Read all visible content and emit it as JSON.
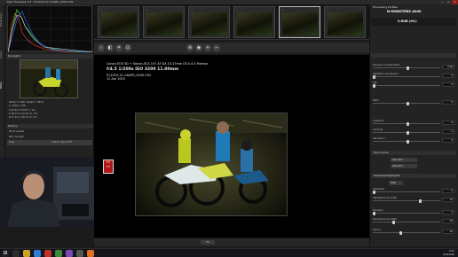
{
  "window": {
    "title": "Raw Therapee 5.8 - E:\\2019-12-14\\IMG_0030.CR2",
    "minimize": "—",
    "maximize": "□",
    "close": "✕"
  },
  "left_tabs": [
    "File Browser",
    "Queue",
    "Editor"
  ],
  "histogram": {
    "colors": {
      "red": "#d03030",
      "green": "#30c030",
      "blue": "#3050e0",
      "luma": "#e0e0e0"
    }
  },
  "navigator": {
    "title": "Navigator",
    "info_lines": [
      "Width = 5796, Height = 3870",
      "x: 1160  y: 768",
      "R  26.6%   H  29.8°   L*  8.1",
      "G  30.1%   S  22.9%   a*  -3.0",
      "B  27.1%   V  30.1%   b*  4.5"
    ]
  },
  "history": {
    "title": "History",
    "items": [
      {
        "label": "Photo loaded"
      },
      {
        "label": "PP3 changed"
      },
      {
        "label": "Crop",
        "detail": "Left=0, Top=2375"
      }
    ]
  },
  "filmstrip": {
    "star": "☆"
  },
  "toolbar": {
    "icons": [
      "info-icon",
      "before-after-icon",
      "crop-icon",
      "zoom-fit-icon",
      "lock-icon",
      "zoom-100-icon",
      "zoom-in-icon",
      "zoom-out-icon"
    ]
  },
  "exif": {
    "camera": "Canon EOS 5D + Tokina AT-X 107 AF DX 10-17mm f/3.5-4.5 Fisheye",
    "settings": "f/4.5   1/200s   ISO 3200   11.00mm",
    "file": "E:\\2019-12-14\\IMG_0030.CR2",
    "date": "12 Apr 2019"
  },
  "right_panel": {
    "title": "Processing Profiles",
    "watermark": "N-MONSTERS A400",
    "profile_name": "0.RUB (0%)",
    "sections": [
      {
        "name": "Tone Curve"
      },
      {
        "name": "Shadows/Highlights"
      }
    ],
    "sliders": [
      {
        "label": "Exposure compensation",
        "value": "0.00",
        "pos": 0.5
      },
      {
        "label": "Highlight compression",
        "value": "0",
        "pos": 0.0
      },
      {
        "label": "Clip",
        "value": "0",
        "pos": 0.0
      },
      {
        "label": "Black",
        "value": "0",
        "pos": 0.5
      },
      {
        "label": "Lightness",
        "value": "0",
        "pos": 0.5
      },
      {
        "label": "Contrast",
        "value": "0",
        "pos": 0.5
      },
      {
        "label": "Saturation",
        "value": "0",
        "pos": 0.5
      },
      {
        "label": "Highlights",
        "value": "0",
        "pos": 0.0
      },
      {
        "label": "Highlight tonal width",
        "value": "70",
        "pos": 0.7
      },
      {
        "label": "Shadows",
        "value": "0",
        "pos": 0.0
      },
      {
        "label": "Shadows tonal width",
        "value": "30",
        "pos": 0.3
      },
      {
        "label": "Radius",
        "value": "40",
        "pos": 0.4
      }
    ],
    "tone_curve_modes": [
      "Standard",
      "Standard"
    ],
    "color_space": "RGB"
  },
  "bottom_bar": {
    "zoom": "Fit"
  },
  "red_overlay": {
    "line1": "FIT",
    "line2": "TV"
  },
  "taskbar": {
    "time": "9:21",
    "date": "12/4/2020"
  }
}
